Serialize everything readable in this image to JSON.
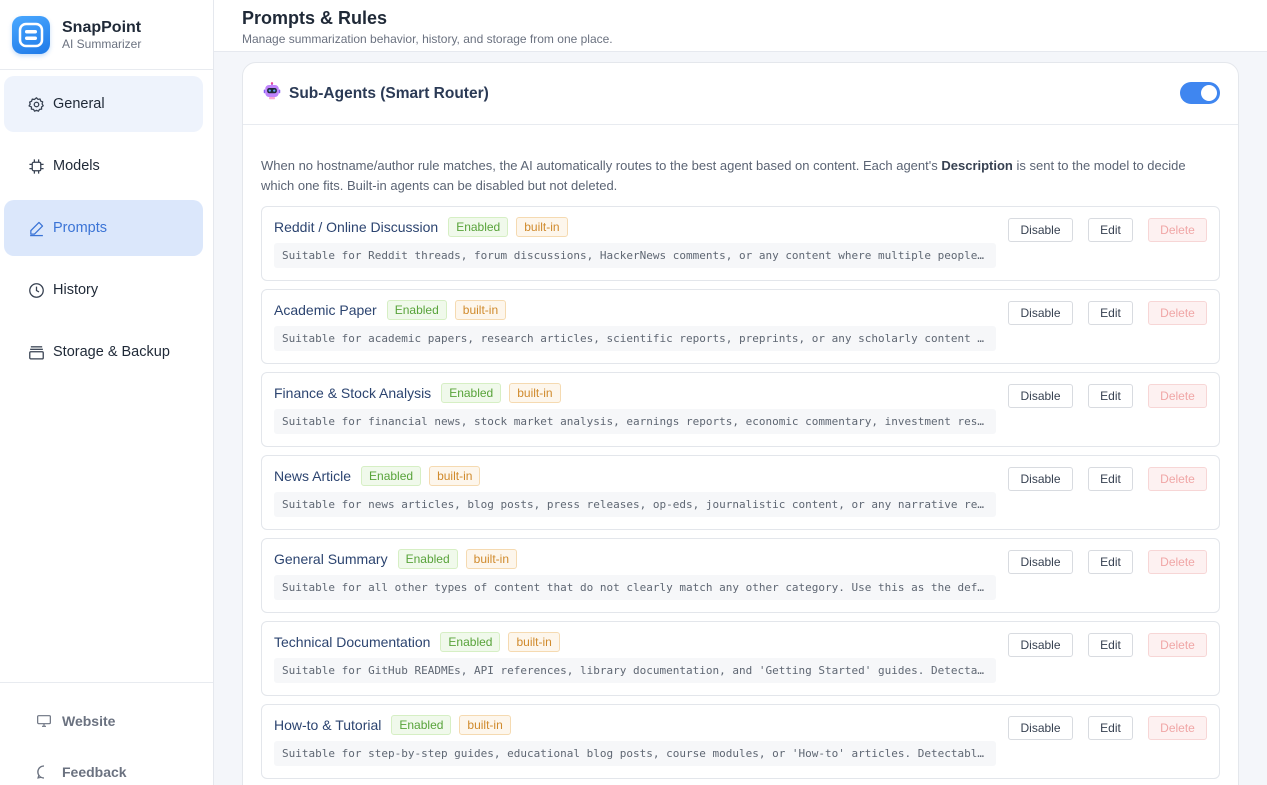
{
  "app": {
    "name": "SnapPoint",
    "subtitle": "AI Summarizer"
  },
  "sidebar": {
    "items": [
      {
        "label": "General",
        "icon": "gear-icon"
      },
      {
        "label": "Models",
        "icon": "chip-icon"
      },
      {
        "label": "Prompts",
        "icon": "pen-icon",
        "active": true
      },
      {
        "label": "History",
        "icon": "clock-icon"
      },
      {
        "label": "Storage & Backup",
        "icon": "archive-icon"
      }
    ],
    "footer": [
      {
        "label": "Website",
        "icon": "monitor-icon"
      },
      {
        "label": "Feedback",
        "icon": "chat-icon"
      }
    ]
  },
  "header": {
    "title": "Prompts & Rules",
    "description": "Manage summarization behavior, history, and storage from one place."
  },
  "section": {
    "title": "Sub-Agents (Smart Router)",
    "icon": "robot-icon",
    "enabled": true,
    "intro_before": "When no hostname/author rule matches, the AI automatically routes to the best agent based on content. Each agent's ",
    "intro_bold": "Description",
    "intro_after": " is sent to the model to decide which one fits. Built-in agents can be disabled but not deleted."
  },
  "labels": {
    "enabled": "Enabled",
    "builtin": "built-in",
    "disable": "Disable",
    "edit": "Edit",
    "delete": "Delete"
  },
  "agents": [
    {
      "name": "Reddit / Online Discussion",
      "description": "Suitable for Reddit threads, forum discussions, HackerNews comments, or any content where multiple people…"
    },
    {
      "name": "Academic Paper",
      "description": "Suitable for academic papers, research articles, scientific reports, preprints, or any scholarly content …"
    },
    {
      "name": "Finance & Stock Analysis",
      "description": "Suitable for financial news, stock market analysis, earnings reports, economic commentary, investment res…"
    },
    {
      "name": "News Article",
      "description": "Suitable for news articles, blog posts, press releases, op-eds, journalistic content, or any narrative re…"
    },
    {
      "name": "General Summary",
      "description": "Suitable for all other types of content that do not clearly match any other category. Use this as the def…"
    },
    {
      "name": "Technical Documentation",
      "description": "Suitable for GitHub READMEs, API references, library documentation, and 'Getting Started' guides. Detecta…"
    },
    {
      "name": "How-to & Tutorial",
      "description": "Suitable for step-by-step guides, educational blog posts, course modules, or 'How-to' articles. Detectabl…"
    }
  ]
}
